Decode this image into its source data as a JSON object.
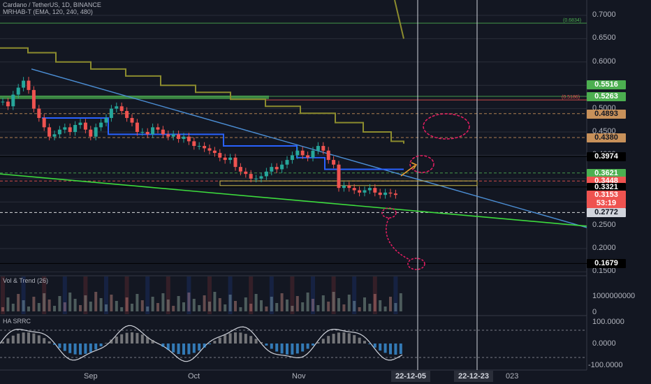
{
  "legends": {
    "main_title": "Cardano / TetherUS, 1D, BINANCE",
    "main_indicator": "MRHAB-T (EMA, 120, 240, 480)",
    "vol_indicator": "Vol & Trend (26)",
    "ha_indicator": "HA SRRC"
  },
  "colors": {
    "background": "#131722",
    "bull": "#26a69a",
    "bear": "#ef5350",
    "trendline": "#4c8fd6",
    "support": "#3ddc3d",
    "olive": "#8c8c2e",
    "dashed_level": "#ffffff",
    "annotation": "#e91e63"
  },
  "badges": [
    {
      "id": "l5516",
      "label": "0.5516",
      "value": 0.5516,
      "bg": "#4caf50",
      "fg": "#ffffff"
    },
    {
      "id": "l5263",
      "label": "0.5263",
      "value": 0.5263,
      "bg": "#4caf50",
      "fg": "#ffffff"
    },
    {
      "id": "l4893",
      "label": "0.4893",
      "value": 0.4893,
      "bg": "#c8915a",
      "fg": "#131722"
    },
    {
      "id": "l4380",
      "label": "0.4380",
      "value": 0.438,
      "bg": "#c8915a",
      "fg": "#131722"
    },
    {
      "id": "l3974",
      "label": "0.3974",
      "value": 0.3974,
      "bg": "#000000",
      "fg": "#ffffff"
    },
    {
      "id": "l3621",
      "label": "0.3621",
      "value": 0.3621,
      "bg": "#4caf50",
      "fg": "#ffffff"
    },
    {
      "id": "l3448",
      "label": "0.3448",
      "value": 0.3448,
      "bg": "#ef5350",
      "fg": "#ffffff"
    },
    {
      "id": "l3321",
      "label": "0.3321",
      "value": 0.3321,
      "bg": "#000000",
      "fg": "#ffffff"
    },
    {
      "id": "l3153",
      "label": "0.3153",
      "value": 0.3153,
      "bg": "#ef5350",
      "fg": "#ffffff"
    },
    {
      "id": "l2772",
      "label": "0.2772",
      "value": 0.2772,
      "bg": "#d1d4dc",
      "fg": "#131722"
    },
    {
      "id": "l1679",
      "label": "0.1679",
      "value": 0.1679,
      "bg": "#000000",
      "fg": "#ffffff"
    }
  ],
  "countdown": "53:19",
  "small_labels": {
    "level_6834": "(0.6834)",
    "level_5186": "(0.5186)"
  },
  "vol_axis": [
    "1000000000",
    "0"
  ],
  "ha_axis": [
    "100.0000",
    "0.0000",
    "-100.0000"
  ],
  "months": [
    "Sep",
    "Oct",
    "Nov"
  ],
  "date_badges": [
    "22-12-05",
    "22-12-23"
  ],
  "year_fragment": "023",
  "chart_data": {
    "type": "candlestick",
    "title": "Cardano / TetherUS, 1D, BINANCE",
    "price_axis": {
      "ticks": [
        "0.7000",
        "0.6500",
        "0.6000",
        "0.5500",
        "0.5000",
        "0.4500",
        "0.4000",
        "0.3500",
        "0.3000",
        "0.2500",
        "0.2000",
        "0.1500"
      ],
      "range": [
        0.15,
        0.72
      ]
    },
    "x_categories": [
      "Sep",
      "Oct",
      "Nov"
    ],
    "close_series": [
      0.515,
      0.505,
      0.53,
      0.545,
      0.56,
      0.54,
      0.5,
      0.48,
      0.46,
      0.44,
      0.445,
      0.455,
      0.46,
      0.45,
      0.465,
      0.47,
      0.455,
      0.44,
      0.46,
      0.47,
      0.48,
      0.5,
      0.505,
      0.495,
      0.48,
      0.47,
      0.45,
      0.45,
      0.445,
      0.46,
      0.455,
      0.445,
      0.44,
      0.445,
      0.435,
      0.44,
      0.43,
      0.42,
      0.42,
      0.415,
      0.41,
      0.405,
      0.395,
      0.39,
      0.395,
      0.375,
      0.365,
      0.36,
      0.35,
      0.35,
      0.355,
      0.365,
      0.375,
      0.37,
      0.38,
      0.39,
      0.4,
      0.41,
      0.4,
      0.395,
      0.41,
      0.42,
      0.41,
      0.39,
      0.38,
      0.33,
      0.335,
      0.33,
      0.325,
      0.32,
      0.325,
      0.33,
      0.32,
      0.315,
      0.32,
      0.318,
      0.315
    ]
  }
}
